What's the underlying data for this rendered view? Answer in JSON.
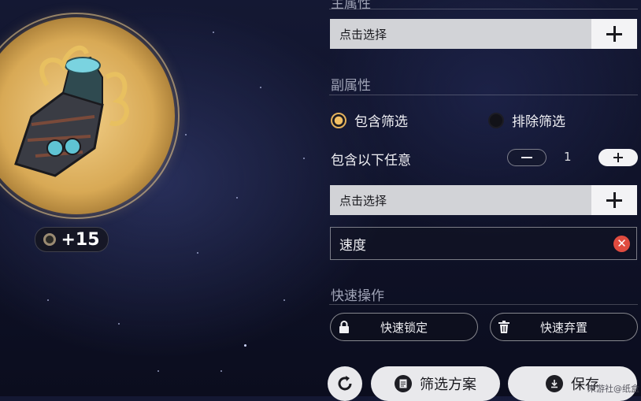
{
  "header": {
    "main_stat_label": "主属性"
  },
  "main_stat_selector": {
    "placeholder": "点击选择"
  },
  "sub_stats": {
    "title": "副属性",
    "filter_modes": [
      {
        "label": "包含筛选",
        "selected": true
      },
      {
        "label": "排除筛选",
        "selected": false
      }
    ],
    "match_label": "包含以下任意",
    "match_count": "1",
    "selector_placeholder": "点击选择",
    "selected_tags": [
      {
        "label": "速度"
      }
    ]
  },
  "quick_actions": {
    "title": "快速操作",
    "lock_label": "快速锁定",
    "discard_label": "快速弃置"
  },
  "footer": {
    "filter_plan_label": "筛选方案",
    "save_label": "保存",
    "watermark": "米游社@纸盒"
  },
  "relic": {
    "level": "+15"
  },
  "colors": {
    "accent_gold": "#e3b15c",
    "remove_red": "#e04b3f",
    "selector_bg": "#d2d3d7"
  },
  "icons": {
    "plus": "plus-icon",
    "minus": "minus-icon",
    "remove": "close-icon",
    "lock": "lock-icon",
    "trash": "trash-icon",
    "refresh": "refresh-icon",
    "document": "document-icon",
    "download": "download-icon"
  }
}
